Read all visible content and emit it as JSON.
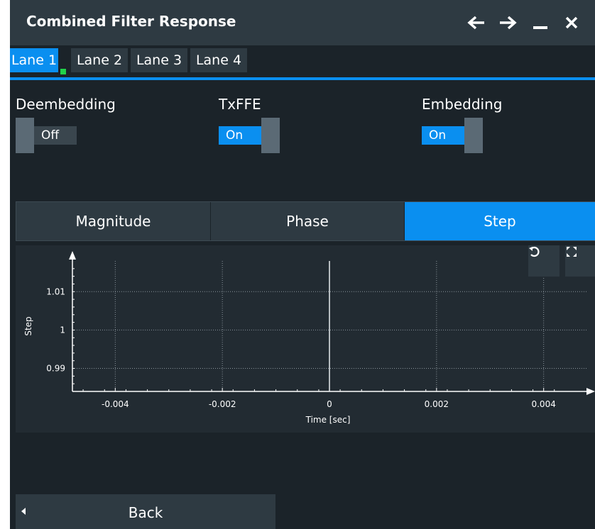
{
  "window": {
    "title": "Combined Filter Response"
  },
  "tabs": [
    {
      "label": "Lane 1",
      "active": true
    },
    {
      "label": "Lane 2",
      "active": false
    },
    {
      "label": "Lane 3",
      "active": false
    },
    {
      "label": "Lane 4",
      "active": false
    }
  ],
  "toggles": {
    "deembedding": {
      "label": "Deembedding",
      "state": "Off"
    },
    "txffe": {
      "label": "TxFFE",
      "state": "On"
    },
    "embedding": {
      "label": "Embedding",
      "state": "On"
    }
  },
  "views": {
    "magnitude": "Magnitude",
    "phase": "Phase",
    "step": "Step",
    "active": "step"
  },
  "colors": {
    "accent": "#0a8ff0",
    "panel": "#2e3a42",
    "background": "#1b2329",
    "indicator": "#21d14a"
  },
  "chart_data": {
    "type": "line",
    "xlabel": "Time [sec]",
    "ylabel": "Step",
    "x_ticks": [
      "-0.004",
      "-0.002",
      "0",
      "0.002",
      "0.004"
    ],
    "y_ticks": [
      "1.01",
      "1",
      "0.99"
    ],
    "xlim": [
      -0.0048,
      0.0048
    ],
    "ylim": [
      0.984,
      1.018
    ],
    "grid": true,
    "series": [
      {
        "x": [
          0,
          0
        ],
        "y": [
          0.984,
          1.018
        ]
      }
    ]
  },
  "back": {
    "label": "Back"
  }
}
